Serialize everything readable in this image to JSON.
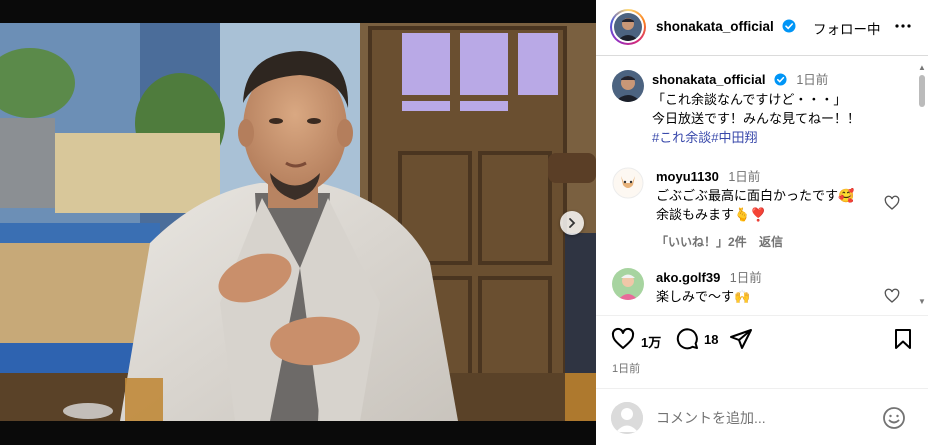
{
  "post": {
    "username": "shonakata_official",
    "follow_label": "フォロー中",
    "more_icon": "more-horizontal-icon"
  },
  "caption": {
    "username": "shonakata_official",
    "time": "1日前",
    "line1": "「これ余談なんですけど・・・」",
    "line2": "今日放送です！みんな見てねー！！",
    "hashtags": "#これ余談#中田翔"
  },
  "comments": [
    {
      "username": "moyu1130",
      "time": "1日前",
      "line1": "ごぶごぶ最高に面白かったです🥰",
      "line2": "余談もみます🫰❣️",
      "likes_label": "「いいね！」2件",
      "reply_label": "返信"
    },
    {
      "username": "ako.golf39",
      "time": "1日前",
      "line1": "楽しみで〜す🙌"
    }
  ],
  "actions": {
    "likes_count": "1万",
    "comments_count": "18",
    "date": "1日前"
  },
  "add_comment": {
    "placeholder": "コメントを追加..."
  },
  "colors": {
    "hashtag": "#3949ab",
    "muted": "#737373",
    "verified": "#0095f6"
  }
}
